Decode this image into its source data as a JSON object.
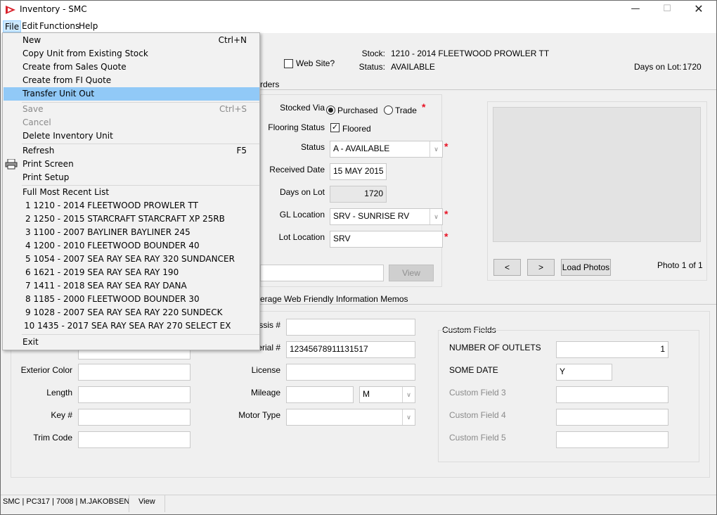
{
  "window": {
    "title": "Inventory - SMC",
    "controls": {
      "minimize": "—",
      "maximize": "☐",
      "close": "✕"
    }
  },
  "menubar": {
    "items": [
      "File",
      "Edit",
      "Functions",
      "Help"
    ]
  },
  "file_menu": {
    "items": [
      {
        "label": "New",
        "shortcut": "Ctrl+N"
      },
      {
        "label": "Copy Unit from Existing Stock"
      },
      {
        "label": "Create from Sales Quote"
      },
      {
        "label": "Create from FI Quote"
      },
      {
        "label": "Transfer Unit Out"
      },
      {
        "label": "Save",
        "shortcut": "Ctrl+S"
      },
      {
        "label": "Cancel"
      },
      {
        "label": "Delete Inventory Unit"
      },
      {
        "label": "Refresh",
        "shortcut": "F5"
      },
      {
        "label": "Print Screen"
      },
      {
        "label": "Print Setup"
      },
      {
        "label": "Full Most Recent List"
      },
      {
        "label": "1  1210 - 2014 FLEETWOOD PROWLER TT"
      },
      {
        "label": "2  1250 - 2015 STARCRAFT STARCRAFT XP 25RB"
      },
      {
        "label": "3  1100 - 2007 BAYLINER BAYLINER 245"
      },
      {
        "label": "4  1200 - 2010 FLEETWOOD BOUNDER 40"
      },
      {
        "label": "5  1054 - 2007 SEA RAY SEA RAY 320 SUNDANCER"
      },
      {
        "label": "6  1621 - 2019 SEA RAY SEA RAY 190"
      },
      {
        "label": "7  1411 - 2018 SEA RAY SEA RAY DANA"
      },
      {
        "label": "8  1185 - 2000 FLEETWOOD BOUNDER 30"
      },
      {
        "label": "9  1028 - 2007 SEA RAY SEA RAY 220 SUNDECK"
      },
      {
        "label": "10  1435 - 2017 SEA RAY SEA RAY 270 SELECT EX"
      },
      {
        "label": "Exit"
      }
    ]
  },
  "header": {
    "web_site_label": "Web Site?",
    "stock_label": "Stock:",
    "stock_value": "1210 - 2014 FLEETWOOD PROWLER TT",
    "status_label": "Status:",
    "status_value": "AVAILABLE",
    "days_on_lot_label": "Days on Lot:",
    "days_on_lot_value": "1720"
  },
  "tabs_top": {
    "partial": "rders"
  },
  "form": {
    "stocked_via_label": "Stocked Via",
    "purchased_label": "Purchased",
    "trade_label": "Trade",
    "flooring_status_label": "Flooring Status",
    "floored_label": "Floored",
    "status_label": "Status",
    "status_value": "A - AVAILABLE",
    "received_date_label": "Received Date",
    "received_date_value": "15 MAY 2015",
    "days_on_lot_label": "Days on Lot",
    "days_on_lot_value": "1720",
    "gl_location_label": "GL Location",
    "gl_location_value": "SRV - SUNRISE RV",
    "lot_location_label": "Lot Location",
    "lot_location_value": "SRV",
    "view_button": "View",
    "required_mark": "*"
  },
  "photos": {
    "prev": "<",
    "next": ">",
    "load": "Load Photos",
    "counter": "Photo 1 of 1"
  },
  "tabs_bottom": {
    "partial": "erage Web Friendly Information Memos"
  },
  "details": {
    "chassis_label": "ssis #",
    "chassis_value": "",
    "serial_label": "erial #",
    "serial_value": "12345678911131517",
    "exterior_color_label": "Exterior Color",
    "length_label": "Length",
    "key_label": "Key #",
    "trim_code_label": "Trim Code",
    "license_label": "License",
    "mileage_label": "Mileage",
    "mileage_unit": "M",
    "motor_type_label": "Motor Type"
  },
  "custom_fields": {
    "title": "Custom Fields",
    "items": [
      {
        "label": "NUMBER OF OUTLETS",
        "value": "1"
      },
      {
        "label": "SOME DATE",
        "value": "Y"
      },
      {
        "label": "Custom Field 3",
        "value": ""
      },
      {
        "label": "Custom Field 4",
        "value": ""
      },
      {
        "label": "Custom Field 5",
        "value": ""
      }
    ]
  },
  "statusbar": {
    "info": "SMC | PC317 | 7008 | M.JAKOBSEN",
    "view": "View"
  },
  "colors": {
    "required": "#e81123",
    "menu_highlight": "#91c9f7"
  }
}
